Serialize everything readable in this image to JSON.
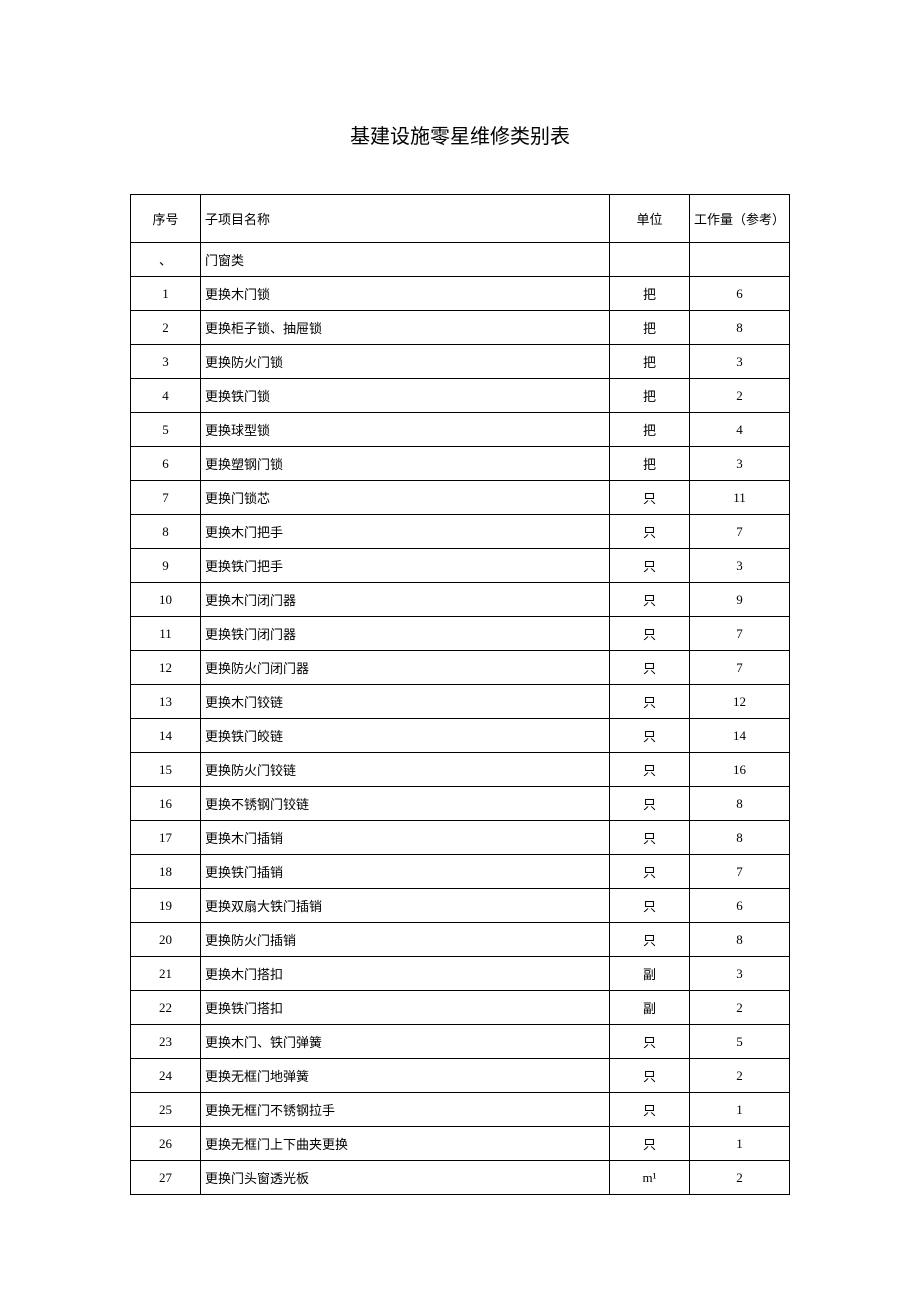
{
  "title": "基建设施零星维修类别表",
  "headers": {
    "seq": "序号",
    "name": "子项目名称",
    "unit": "单位",
    "workload": "工作量（参考）"
  },
  "section": {
    "marker": "、",
    "label": "门窗类"
  },
  "rows": [
    {
      "seq": "1",
      "name": "更换木门锁",
      "unit": "把",
      "workload": "6"
    },
    {
      "seq": "2",
      "name": "更换柜子锁、抽屉锁",
      "unit": "把",
      "workload": "8"
    },
    {
      "seq": "3",
      "name": "更换防火门锁",
      "unit": "把",
      "workload": "3"
    },
    {
      "seq": "4",
      "name": "更换铁门锁",
      "unit": "把",
      "workload": "2"
    },
    {
      "seq": "5",
      "name": "更换球型锁",
      "unit": "把",
      "workload": "4"
    },
    {
      "seq": "6",
      "name": "更换塑钢门锁",
      "unit": "把",
      "workload": "3"
    },
    {
      "seq": "7",
      "name": "更换门锁芯",
      "unit": "只",
      "workload": "11"
    },
    {
      "seq": "8",
      "name": "更换木门把手",
      "unit": "只",
      "workload": "7"
    },
    {
      "seq": "9",
      "name": "更换铁门把手",
      "unit": "只",
      "workload": "3"
    },
    {
      "seq": "10",
      "name": "更换木门闭门器",
      "unit": "只",
      "workload": "9"
    },
    {
      "seq": "11",
      "name": "更换铁门闭门器",
      "unit": "只",
      "workload": "7"
    },
    {
      "seq": "12",
      "name": "更换防火门闭门器",
      "unit": "只",
      "workload": "7"
    },
    {
      "seq": "13",
      "name": "更换木门铰链",
      "unit": "只",
      "workload": "12"
    },
    {
      "seq": "14",
      "name": "更换铁门皎链",
      "unit": "只",
      "workload": "14"
    },
    {
      "seq": "15",
      "name": "更换防火门铰链",
      "unit": "只",
      "workload": "16"
    },
    {
      "seq": "16",
      "name": "更换不锈钢门铰链",
      "unit": "只",
      "workload": "8"
    },
    {
      "seq": "17",
      "name": "更换木门插销",
      "unit": "只",
      "workload": "8"
    },
    {
      "seq": "18",
      "name": "更换铁门插销",
      "unit": "只",
      "workload": "7"
    },
    {
      "seq": "19",
      "name": "更换双扇大铁门插销",
      "unit": "只",
      "workload": "6"
    },
    {
      "seq": "20",
      "name": "更换防火门插销",
      "unit": "只",
      "workload": "8"
    },
    {
      "seq": "21",
      "name": "更换木门搭扣",
      "unit": "副",
      "workload": "3"
    },
    {
      "seq": "22",
      "name": "更换铁门搭扣",
      "unit": "副",
      "workload": "2"
    },
    {
      "seq": "23",
      "name": "更换木门、铁门弹簧",
      "unit": "只",
      "workload": "5"
    },
    {
      "seq": "24",
      "name": "更换无框门地弹簧",
      "unit": "只",
      "workload": "2"
    },
    {
      "seq": "25",
      "name": "更换无框门不锈钢拉手",
      "unit": "只",
      "workload": "1"
    },
    {
      "seq": "26",
      "name": "更换无框门上下曲夹更换",
      "unit": "只",
      "workload": "1"
    },
    {
      "seq": "27",
      "name": "更换门头窗透光板",
      "unit": "m¹",
      "workload": "2"
    }
  ]
}
